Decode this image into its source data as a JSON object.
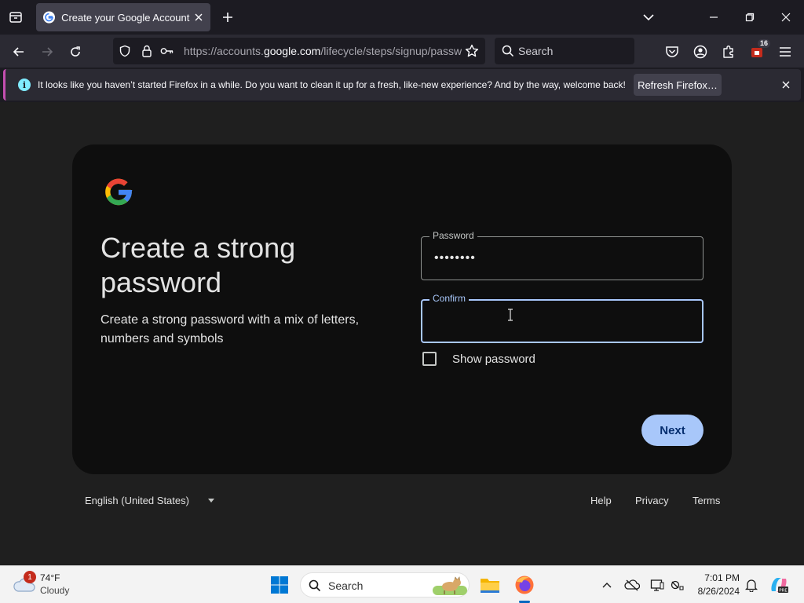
{
  "browser": {
    "tab": {
      "title": "Create your Google Account"
    },
    "url": {
      "prefix": "https://accounts.",
      "host": "google.com",
      "path": "/lifecycle/steps/signup/passw"
    },
    "search_placeholder": "Search",
    "extensions_badge": "16"
  },
  "notification": {
    "message": "It looks like you haven’t started Firefox in a while. Do you want to clean it up for a fresh, like-new experience? And by the way, welcome back!",
    "button_label": "Refresh Firefox…"
  },
  "signup": {
    "title": "Create a strong password",
    "subtitle": "Create a strong password with a mix of letters, numbers and symbols",
    "password_label": "Password",
    "password_value": "••••••••",
    "confirm_label": "Confirm",
    "confirm_value": "",
    "show_password_label": "Show password",
    "show_password_checked": false,
    "next_label": "Next"
  },
  "footer": {
    "language": "English (United States)",
    "links": [
      "Help",
      "Privacy",
      "Terms"
    ]
  },
  "taskbar": {
    "weather_temp": "74°F",
    "weather_condition": "Cloudy",
    "weather_badge": "1",
    "search_placeholder": "Search",
    "time": "7:01 PM",
    "date": "8/26/2024"
  },
  "colors": {
    "accent": "#a8c7fa",
    "next_text": "#062e6f",
    "notification_accent": "#c44eb0"
  }
}
